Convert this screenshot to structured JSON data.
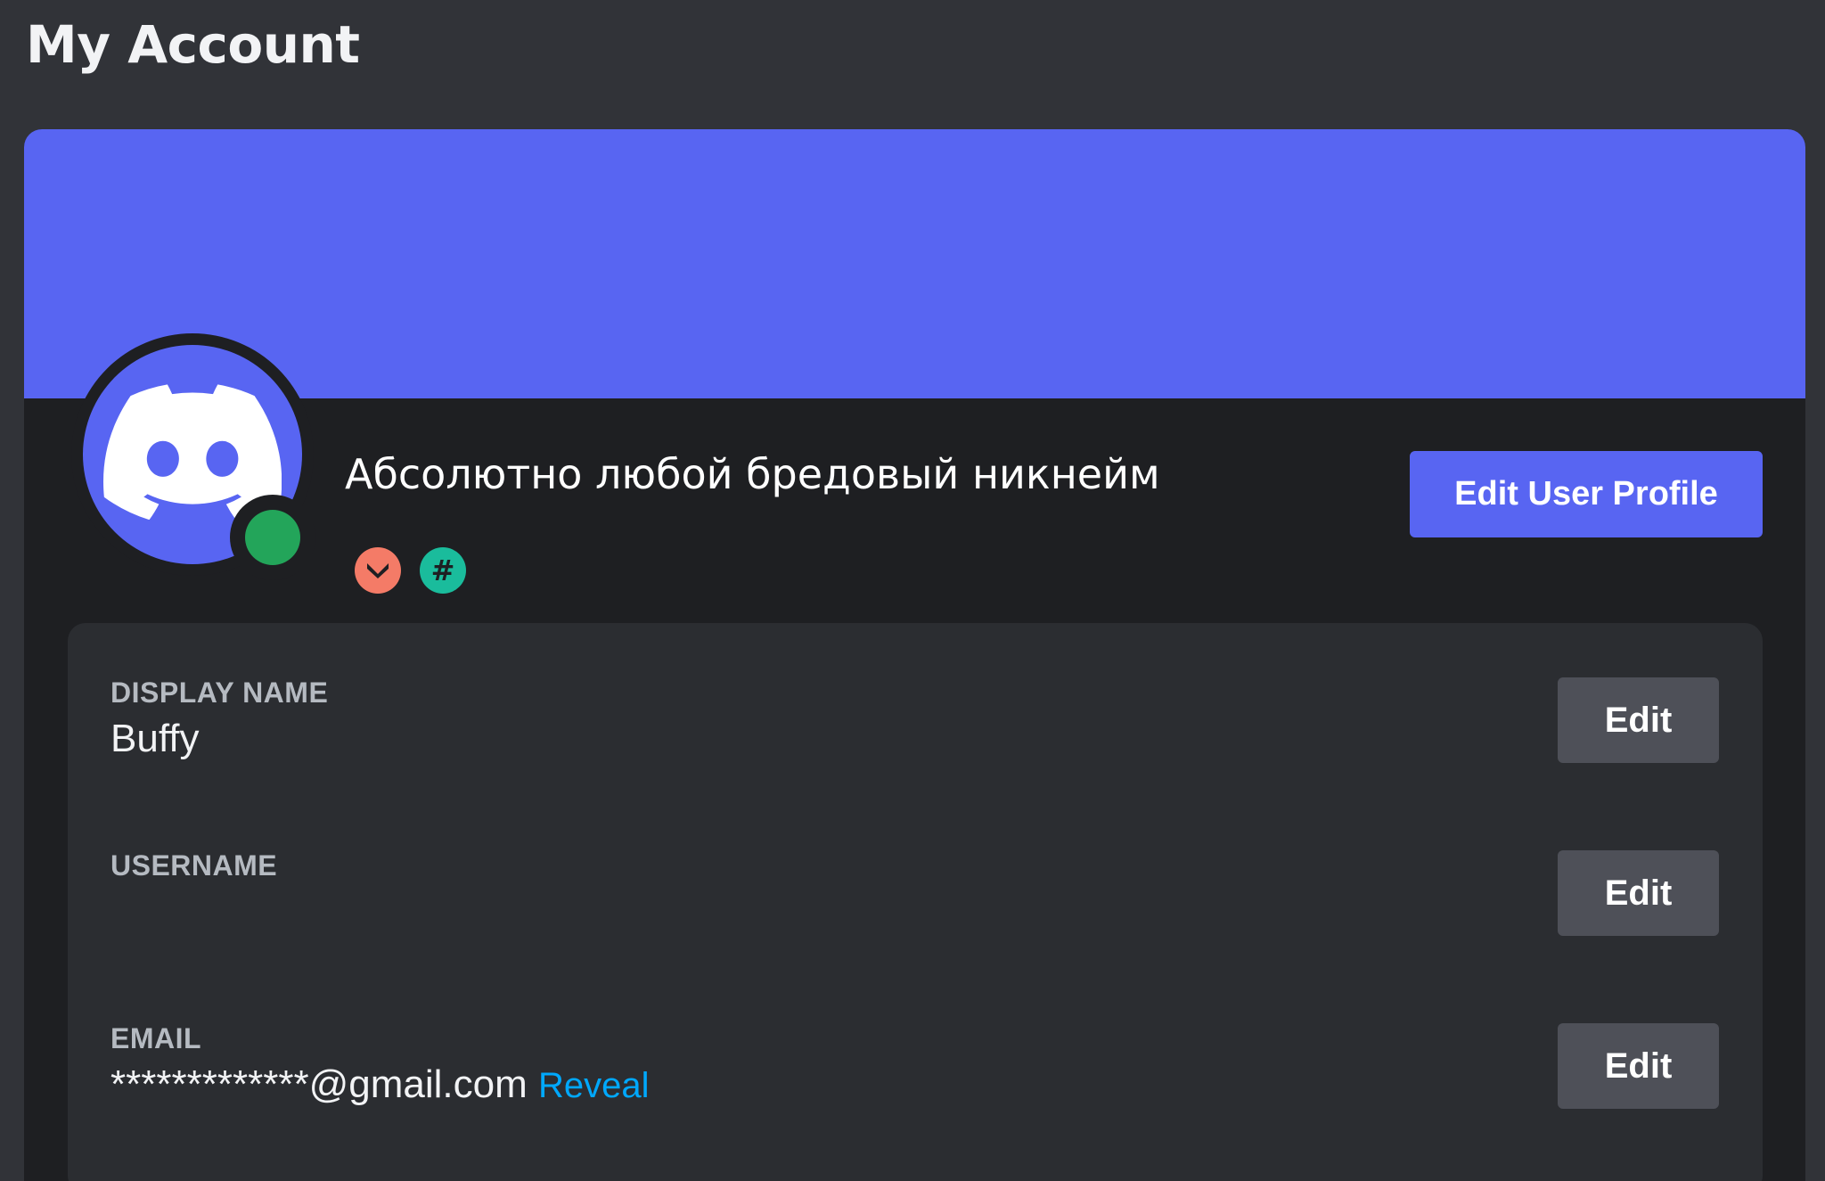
{
  "page": {
    "title": "My Account"
  },
  "profile": {
    "banner_color": "#5865f2",
    "avatar_icon": "discord-logo-icon",
    "status": "online",
    "status_color": "#23a55a",
    "nickname": "Абсолютно любой бредовый никнейм",
    "badges": [
      {
        "icon": "hypesquad-brilliance-icon",
        "color": "#f47b67"
      },
      {
        "icon": "hashtag-icon",
        "label": "#",
        "color": "#1abc9c"
      }
    ],
    "edit_profile_label": "Edit User Profile"
  },
  "fields": {
    "display_name": {
      "label": "DISPLAY NAME",
      "value": "Buffy",
      "edit_label": "Edit"
    },
    "username": {
      "label": "USERNAME",
      "value": "",
      "edit_label": "Edit"
    },
    "email": {
      "label": "EMAIL",
      "value": "*************@gmail.com",
      "reveal_label": "Reveal",
      "edit_label": "Edit"
    }
  }
}
